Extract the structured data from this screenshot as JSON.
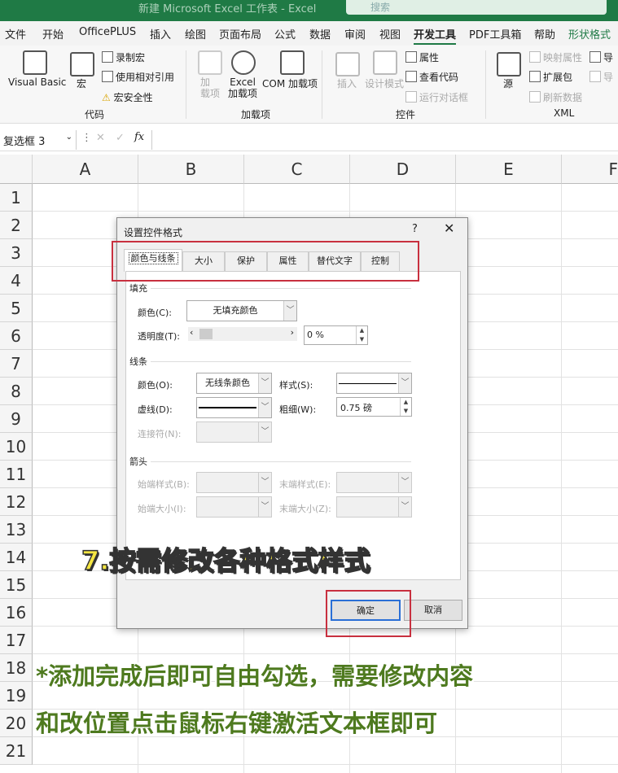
{
  "titlebar": {
    "title": "新建 Microsoft Excel 工作表 - Excel",
    "search": "搜索"
  },
  "menu_tabs": [
    "文件",
    "开始",
    "OfficePLUS",
    "插入",
    "绘图",
    "页面布局",
    "公式",
    "数据",
    "审阅",
    "视图",
    "开发工具",
    "PDF工具箱",
    "帮助",
    "形状格式"
  ],
  "ribbon": {
    "code": {
      "group": "代码",
      "visual_basic": "Visual Basic",
      "macro": "宏",
      "record": "录制宏",
      "relative": "使用相对引用",
      "security": "宏安全性"
    },
    "addins": {
      "group": "加载项",
      "addins": "加\n载项",
      "excel_addins": "Excel\n加载项",
      "com_addins": "COM 加载项"
    },
    "controls": {
      "group": "控件",
      "insert": "插入",
      "design": "设计模式",
      "properties": "属性",
      "view_code": "查看代码",
      "run_dialog": "运行对话框"
    },
    "xml": {
      "group": "XML",
      "source": "源",
      "map_props": "映射属性",
      "expansion": "扩展包",
      "refresh": "刷新数据",
      "import": "导",
      "export": "导"
    }
  },
  "formula_bar": {
    "name_box": "复选框 3",
    "fx": "fx"
  },
  "columns": [
    "A",
    "B",
    "C",
    "D",
    "E",
    "F"
  ],
  "rows": [
    "1",
    "2",
    "3",
    "4",
    "5",
    "6",
    "7",
    "8",
    "9",
    "10",
    "11",
    "12",
    "13",
    "14",
    "15",
    "16",
    "17",
    "18",
    "19",
    "20",
    "21"
  ],
  "dialog": {
    "title": "设置控件格式",
    "help": "?",
    "close": "✕",
    "tabs": [
      "颜色与线条",
      "大小",
      "保护",
      "属性",
      "替代文字",
      "控制"
    ],
    "fill": {
      "section": "填充",
      "color_label": "颜色(C):",
      "color_value": "无填充颜色",
      "transparency_label": "透明度(T):",
      "transparency_value": "0 %"
    },
    "line": {
      "section": "线条",
      "color_label": "颜色(O):",
      "color_value": "无线条颜色",
      "style_label": "样式(S):",
      "dash_label": "虚线(D):",
      "weight_label": "粗细(W):",
      "weight_value": "0.75 磅",
      "connector_label": "连接符(N):"
    },
    "arrows": {
      "section": "箭头",
      "begin_style": "始端样式(B):",
      "end_style": "末端样式(E):",
      "begin_size": "始端大小(I):",
      "end_size": "末端大小(Z):"
    },
    "ok": "确定",
    "cancel": "取消"
  },
  "caption": "7.按需修改各种格式样式",
  "note": [
    "*添加完成后即可自由勾选，需要修改内容",
    "和改位置点击鼠标右键激活文本框即可"
  ]
}
